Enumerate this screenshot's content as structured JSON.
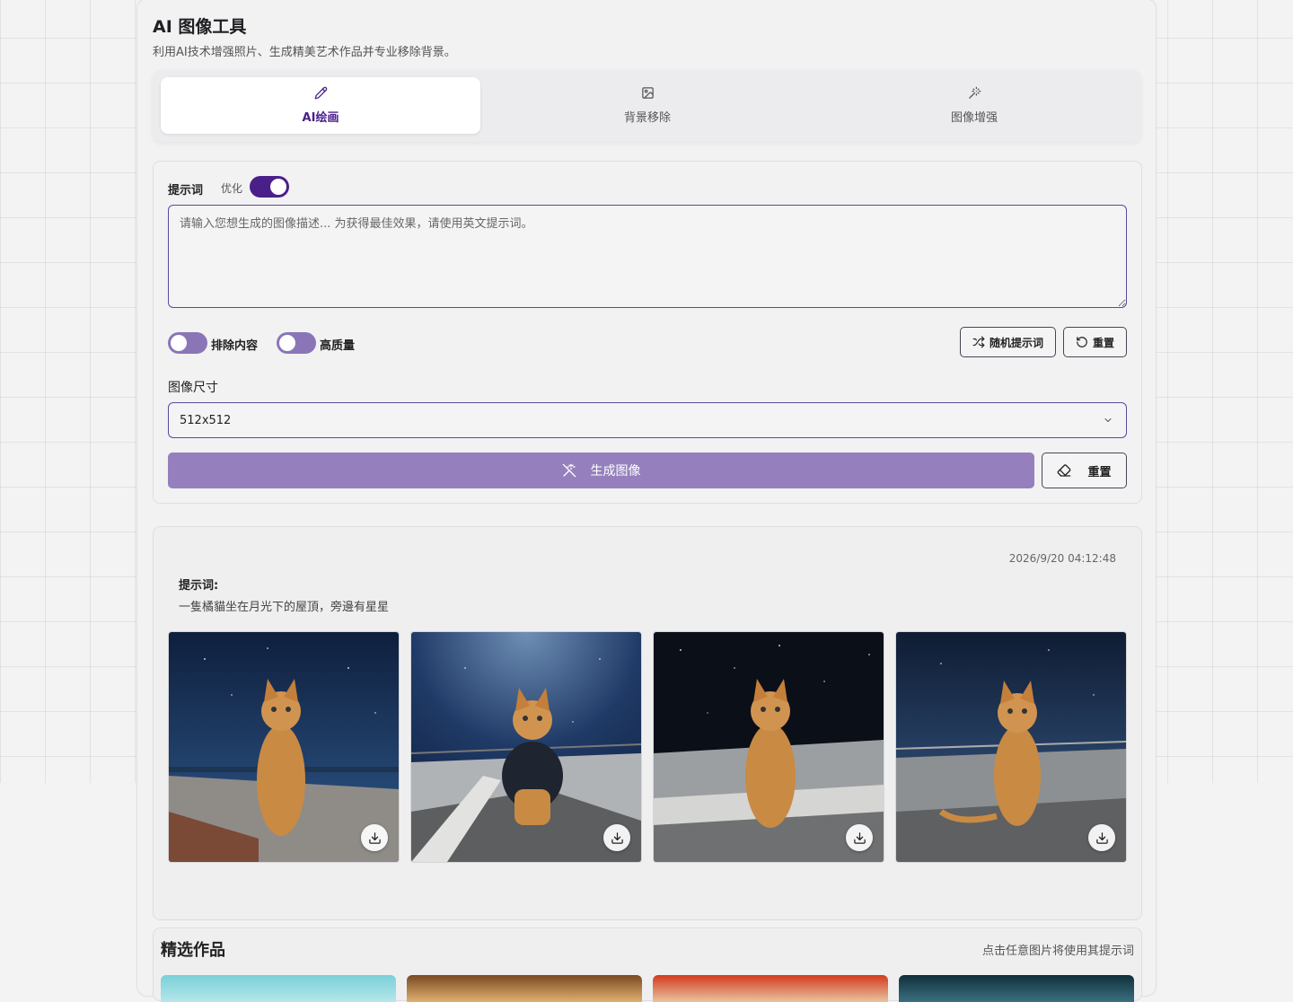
{
  "app": {
    "title": "AI 图像工具",
    "subtitle": "利用AI技术增强照片、生成精美艺术作品并专业移除背景。"
  },
  "tabs": [
    {
      "label": "AI绘画",
      "icon": "pencil-icon",
      "active": true
    },
    {
      "label": "背景移除",
      "icon": "image-icon",
      "active": false
    },
    {
      "label": "图像增强",
      "icon": "magic-wand-icon",
      "active": false
    }
  ],
  "prompt": {
    "label": "提示词",
    "optimize_label": "优化",
    "optimize_on": true,
    "value": "",
    "placeholder": "请输入您想生成的图像描述... 为获得最佳效果，请使用英文提示词。"
  },
  "options": {
    "exclude_label": "排除内容",
    "exclude_on": false,
    "hq_label": "高质量",
    "hq_on": false,
    "random_prompt_label": "随机提示词",
    "reset_label": "重置"
  },
  "size": {
    "label": "图像尺寸",
    "selected": "512x512"
  },
  "actions": {
    "generate_label": "生成图像",
    "reset_label": "重置"
  },
  "result": {
    "timestamp": "2026/9/20 04:12:48",
    "prompt_label": "提示词:",
    "prompt_text": "一隻橘貓坐在月光下的屋頂，旁邊有星星",
    "image_count": 4
  },
  "featured": {
    "title": "精选作品",
    "hint": "点击任意图片将使用其提示词"
  },
  "colors": {
    "accent": "#4a1f8a",
    "generate_button": "#9580bd"
  }
}
